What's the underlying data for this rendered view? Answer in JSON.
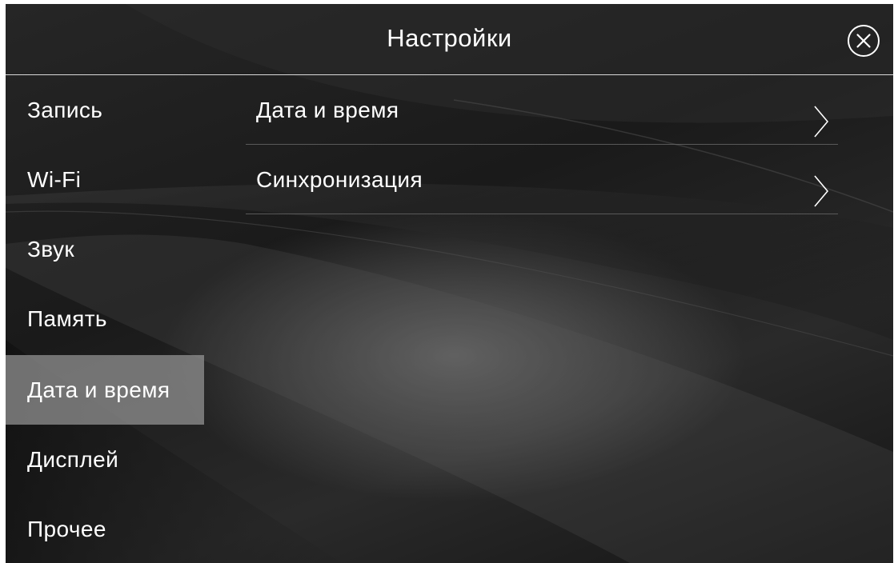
{
  "header": {
    "title": "Настройки",
    "close_icon": "close-circle-icon"
  },
  "sidebar": {
    "items": [
      {
        "label": "Запись"
      },
      {
        "label": "Wi-Fi"
      },
      {
        "label": "Звук"
      },
      {
        "label": "Память"
      },
      {
        "label": "Дата и время",
        "active": true
      },
      {
        "label": "Дисплей"
      },
      {
        "label": "Прочее"
      }
    ],
    "active_color": "#969696"
  },
  "content": {
    "items": [
      {
        "label": "Дата и время",
        "icon": "chevron-right-icon"
      },
      {
        "label": "Синхронизация",
        "icon": "chevron-right-icon"
      }
    ]
  }
}
